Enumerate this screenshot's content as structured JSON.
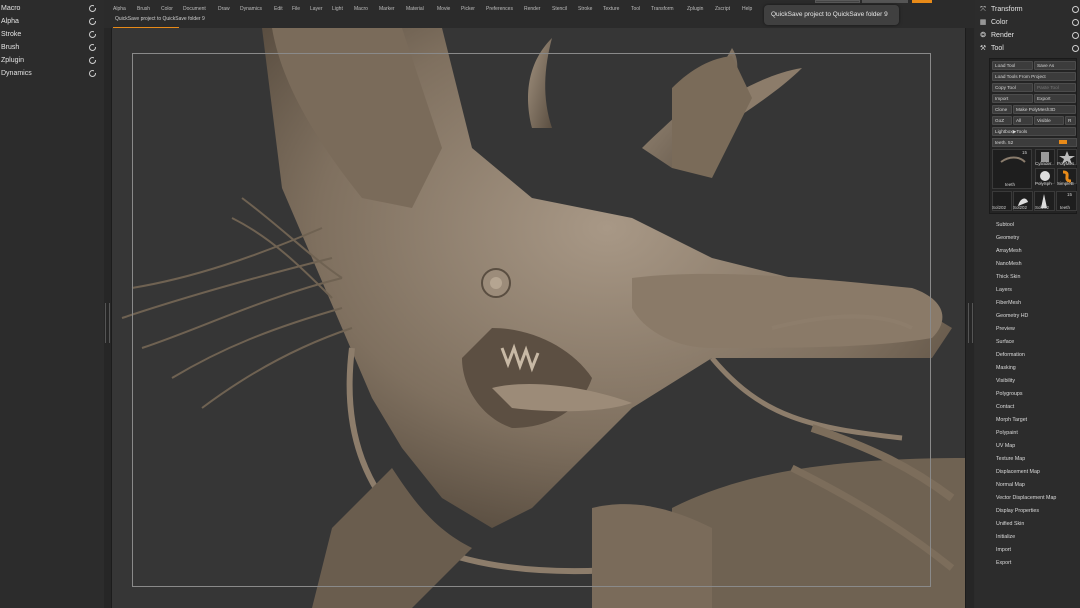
{
  "left_palette": {
    "items": [
      {
        "label": "Macro"
      },
      {
        "label": "Alpha"
      },
      {
        "label": "Stroke"
      },
      {
        "label": "Brush"
      },
      {
        "label": "Zplugin"
      },
      {
        "label": "Dynamics"
      }
    ]
  },
  "menubar": {
    "items": [
      "Alpha",
      "Brush",
      "Color",
      "Document",
      "Draw",
      "Dynamics",
      "Edit",
      "File",
      "Layer",
      "Light",
      "Macro",
      "Marker",
      "Material",
      "Movie",
      "Picker",
      "Preferences",
      "Render",
      "Stencil",
      "Stroke",
      "Texture",
      "Tool",
      "Transform",
      "Zplugin",
      "Zscript",
      "Help"
    ]
  },
  "status": {
    "text": "QuickSave project to QuickSave folder 9",
    "progress": 1.0
  },
  "tooltip": {
    "text": "QuickSave project to QuickSave folder  9"
  },
  "right_tray": {
    "menus": [
      {
        "label": "Transform",
        "icon": "transform-icon"
      },
      {
        "label": "Color",
        "icon": "color-icon"
      },
      {
        "label": "Render",
        "icon": "render-icon"
      },
      {
        "label": "Tool",
        "icon": "tool-icon"
      }
    ],
    "tool_buttons": {
      "load_tool": "Load Tool",
      "save_as": "Save As",
      "load_tools_from_project": "Load Tools From Project",
      "copy_tool": "Copy Tool",
      "paste_tool": "Paste Tool",
      "import": "Import",
      "export": "Export",
      "clone": "Clone",
      "make_polymesh3d": "Make PolyMesh3D",
      "goz": "GoZ",
      "all": "All",
      "visible": "Visible",
      "r": "R",
      "lightbox_tools": "Lightbox▶Tools"
    },
    "slider": {
      "label": "teeth.",
      "value": "52",
      "fill": 0.85
    },
    "thumbnails": [
      {
        "label": "teeth",
        "count": "15"
      },
      {
        "label": "Cylinder"
      },
      {
        "label": "PolyMes"
      },
      {
        "label": "PolySph"
      },
      {
        "label": "SimpleB"
      },
      {
        "label": "Sol202"
      },
      {
        "label": "Sol202"
      },
      {
        "label": "Sol202"
      },
      {
        "label": "teeth",
        "count": "15"
      }
    ],
    "sub_items": [
      "Subtool",
      "Geometry",
      "ArrayMesh",
      "NanoMesh",
      "Thick Skin",
      "Layers",
      "FiberMesh",
      "Geometry HD",
      "Preview",
      "Surface",
      "Deformation",
      "Masking",
      "Visibility",
      "Polygroups",
      "Contact",
      "Morph Target",
      "Polypaint",
      "UV Map",
      "Texture Map",
      "Displacement Map",
      "Normal Map",
      "Vector Displacement Map",
      "Display Properties",
      "Unified Skin",
      "Initialize",
      "Import",
      "Export"
    ]
  },
  "colors": {
    "accent": "#e88a18",
    "panel": "#2c2c2c",
    "canvas": "#353535",
    "clay": "#8e7f6e"
  }
}
